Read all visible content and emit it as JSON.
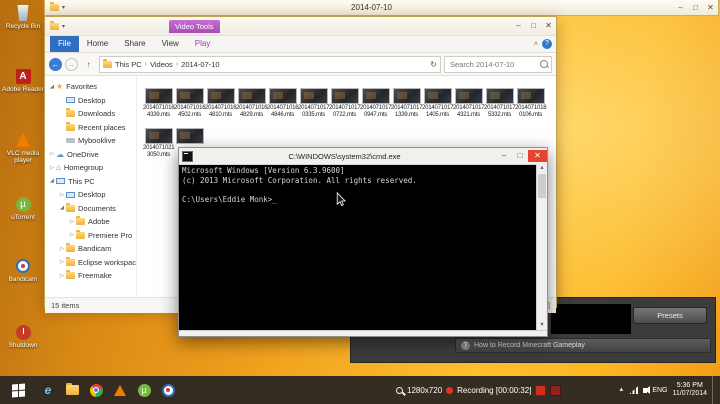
{
  "background_window": {
    "title": "2014-07-10"
  },
  "desktop": {
    "icons": [
      {
        "label": "Recycle Bin",
        "type": "recycle-bin"
      },
      {
        "label": "Adobe Reader",
        "type": "adobe-reader"
      },
      {
        "label": "VLC media player",
        "type": "vlc"
      },
      {
        "label": "uTorrent",
        "type": "utorrent"
      },
      {
        "label": "Bandicam",
        "type": "bandicam"
      },
      {
        "label": "Shutdown",
        "type": "shutdown"
      }
    ]
  },
  "explorer": {
    "contextual_label": "Video Tools",
    "tabs": [
      "File",
      "Home",
      "Share",
      "View",
      "Play"
    ],
    "breadcrumb": [
      "This PC",
      "Videos",
      "2014-07-10"
    ],
    "search_placeholder": "Search 2014-07-10",
    "nav": [
      {
        "label": "Favorites",
        "level": 0,
        "icon": "star",
        "exp": "open"
      },
      {
        "label": "Desktop",
        "level": 1,
        "icon": "monitor",
        "exp": "none"
      },
      {
        "label": "Downloads",
        "level": 1,
        "icon": "folder",
        "exp": "none"
      },
      {
        "label": "Recent places",
        "level": 1,
        "icon": "folder",
        "exp": "none"
      },
      {
        "label": "Mybooklive",
        "level": 1,
        "icon": "drive",
        "exp": "none"
      },
      {
        "label": "OneDrive",
        "level": 0,
        "icon": "cloud",
        "exp": "closed"
      },
      {
        "label": "Homegroup",
        "level": 0,
        "icon": "house",
        "exp": "closed"
      },
      {
        "label": "This PC",
        "level": 0,
        "icon": "monitor",
        "exp": "open"
      },
      {
        "label": "Desktop",
        "level": 1,
        "icon": "monitor",
        "exp": "closed"
      },
      {
        "label": "Documents",
        "level": 1,
        "icon": "folder",
        "exp": "open"
      },
      {
        "label": "Adobe",
        "level": 2,
        "icon": "folder",
        "exp": "closed"
      },
      {
        "label": "Premiere Pro",
        "level": 2,
        "icon": "folder",
        "exp": "closed"
      },
      {
        "label": "Bandicam",
        "level": 1,
        "icon": "folder",
        "exp": "closed"
      },
      {
        "label": "Eclipse workspace",
        "level": 1,
        "icon": "folder",
        "exp": "closed"
      },
      {
        "label": "Freemake",
        "level": 1,
        "icon": "folder",
        "exp": "closed"
      }
    ],
    "files": [
      "20140710164339.mts",
      "20140710164502.mts",
      "20140710164810.mts",
      "20140710164829.mts",
      "20140710164846.mts",
      "20140710170335.mts",
      "20140710170722.mts",
      "20140710170947.mts",
      "20140710171339.mts",
      "20140710171405.mts",
      "20140710174321.mts",
      "20140710175332.mts",
      "20140710180106.mts",
      "20140710213050.mts",
      ""
    ],
    "status": "15 items"
  },
  "cmd": {
    "title": "C:\\WINDOWS\\system32\\cmd.exe",
    "lines": [
      "Microsoft Windows [Version 6.3.9600]",
      "(c) 2013 Microsoft Corporation. All rights reserved.",
      "",
      "C:\\Users\\Eddie Monk>_"
    ]
  },
  "recorder": {
    "presets_label": "Presets",
    "help_text": "How to Record Minecraft Gameplay"
  },
  "taskbar": {
    "app_icons": [
      "ie",
      "explorer",
      "chrome",
      "vlc",
      "utorrent",
      "bandicam"
    ],
    "resolution": "1280x720",
    "recording_label": "Recording [00:00:32]",
    "language": "ENG",
    "time": "5:36 PM",
    "date": "11/07/2014"
  }
}
